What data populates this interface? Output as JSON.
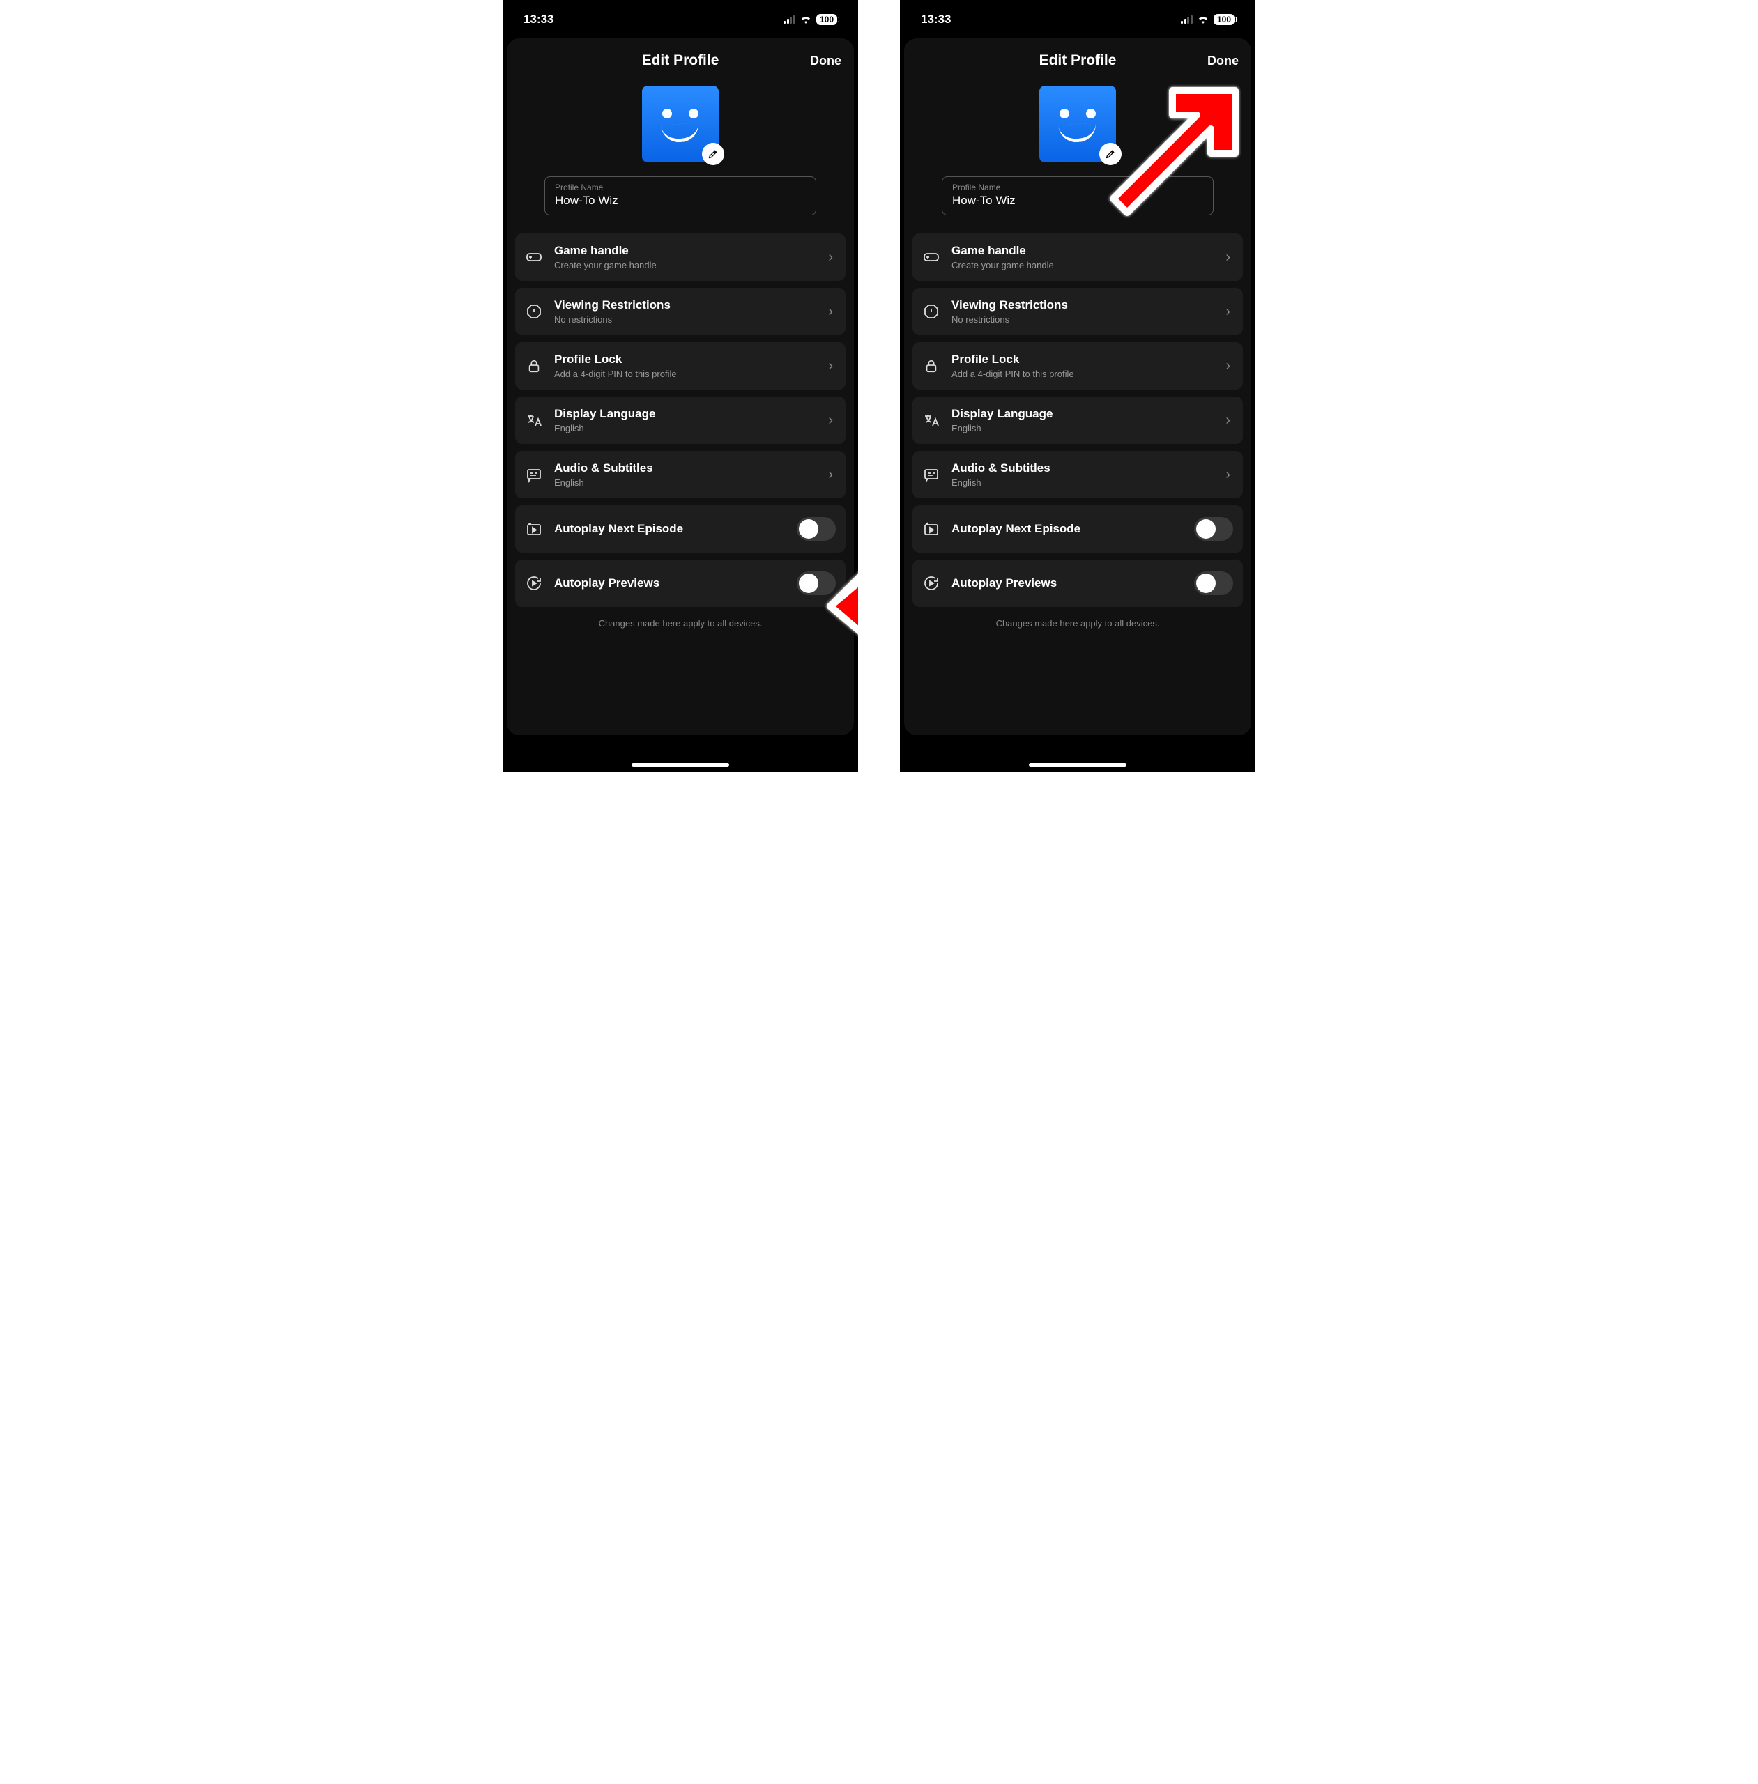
{
  "status": {
    "time": "13:33",
    "battery": "100"
  },
  "header": {
    "title": "Edit Profile",
    "done": "Done"
  },
  "profile": {
    "name_label": "Profile Name",
    "name_value": "How-To Wiz"
  },
  "rows": {
    "game": {
      "title": "Game handle",
      "sub": "Create your game handle"
    },
    "view": {
      "title": "Viewing Restrictions",
      "sub": "No restrictions"
    },
    "lock": {
      "title": "Profile Lock",
      "sub": "Add a 4-digit PIN to this profile"
    },
    "lang": {
      "title": "Display Language",
      "sub": "English"
    },
    "audio": {
      "title": "Audio & Subtitles",
      "sub": "English"
    },
    "next": {
      "title": "Autoplay Next Episode"
    },
    "prev": {
      "title": "Autoplay Previews"
    }
  },
  "footnote": "Changes made here apply to all devices.",
  "toggles": {
    "autoplay_next": false,
    "autoplay_previews": false
  }
}
